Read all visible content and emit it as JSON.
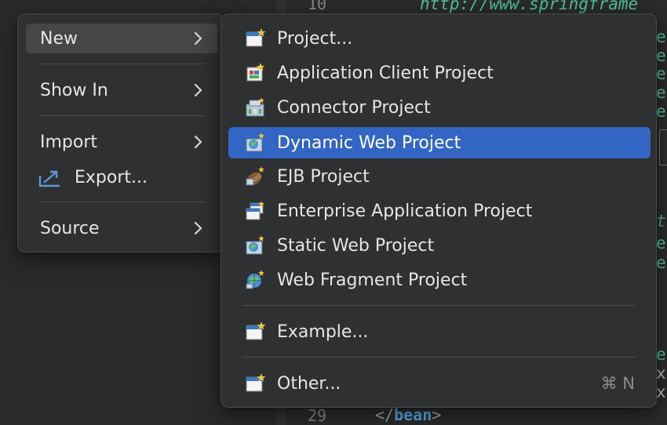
{
  "editor": {
    "line_top": "10",
    "url_text": "http://www.springframe",
    "right_frags": [
      "e",
      "e",
      "e",
      "e",
      "e",
      "t",
      "e",
      "e",
      "e",
      "x",
      "x"
    ],
    "line_bottom": "29",
    "closing_tag_open": "</",
    "closing_tag_name": "bean",
    "closing_tag_close": ">"
  },
  "context_menu": {
    "items": [
      {
        "label": "New",
        "has_submenu": true
      },
      {
        "label": "Show In",
        "has_submenu": true
      },
      {
        "label": "Import",
        "has_submenu": true
      },
      {
        "label": "Export...",
        "has_submenu": false,
        "icon": "export-icon"
      },
      {
        "label": "Source",
        "has_submenu": true
      }
    ]
  },
  "new_submenu": {
    "items": [
      {
        "label": "Project...",
        "icon": "new-project-icon"
      },
      {
        "label": "Application Client Project",
        "icon": "application-client-project-icon"
      },
      {
        "label": "Connector Project",
        "icon": "connector-project-icon"
      },
      {
        "label": "Dynamic Web Project",
        "icon": "dynamic-web-project-icon",
        "selected": true
      },
      {
        "label": "EJB Project",
        "icon": "ejb-project-icon"
      },
      {
        "label": "Enterprise Application Project",
        "icon": "enterprise-application-project-icon"
      },
      {
        "label": "Static Web Project",
        "icon": "static-web-project-icon"
      },
      {
        "label": "Web Fragment Project",
        "icon": "web-fragment-project-icon"
      },
      {
        "label": "Example...",
        "icon": "example-icon"
      },
      {
        "label": "Other...",
        "icon": "other-icon",
        "shortcut": "⌘ N"
      }
    ]
  },
  "colors": {
    "selection": "#3366c4",
    "menu_bg": "#2f3031",
    "code_teal": "#4fc1a0"
  }
}
